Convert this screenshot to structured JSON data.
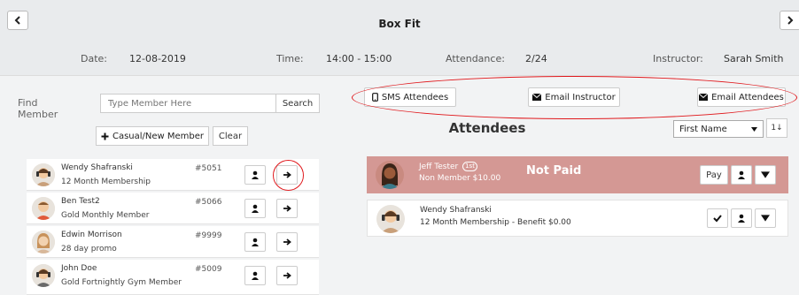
{
  "header": {
    "title": "Box Fit",
    "date_label": "Date:",
    "date_value": "12-08-2019",
    "time_label": "Time:",
    "time_value": "14:00 - 15:00",
    "attendance_label": "Attendance:",
    "attendance_value": "2/24",
    "instructor_label": "Instructor:",
    "instructor_value": "Sarah Smith"
  },
  "search": {
    "find_label": "Find Member",
    "placeholder": "Type Member Here",
    "search_button": "Search",
    "casual_button": "Casual/New Member",
    "clear_button": "Clear"
  },
  "members": [
    {
      "name": "Wendy Shafranski",
      "plan": "12 Month Membership",
      "number": "#5051"
    },
    {
      "name": "Ben Test2",
      "plan": "Gold Monthly Member",
      "number": "#5066"
    },
    {
      "name": "Edwin Morrison",
      "plan": "28 day promo",
      "number": "#9999"
    },
    {
      "name": "John Doe",
      "plan": "Gold Fortnightly Gym Member",
      "number": "#5009"
    }
  ],
  "actions": {
    "sms": "SMS Attendees",
    "email_instructor": "Email Instructor",
    "email_attendees": "Email Attendees"
  },
  "attendees_panel": {
    "title": "Attendees",
    "sort_value": "First Name",
    "sort_icon": "1↓"
  },
  "attendees": [
    {
      "name": "Jeff Tester",
      "badge": "1st",
      "plan": "Non Member $10.00",
      "status": "Not Paid",
      "pay_label": "Pay"
    },
    {
      "name": "Wendy Shafranski",
      "plan": "12 Month Membership - Benefit $0.00"
    }
  ],
  "colors": {
    "unpaid_row": "#d49894",
    "annotation_red": "#e0191d"
  }
}
